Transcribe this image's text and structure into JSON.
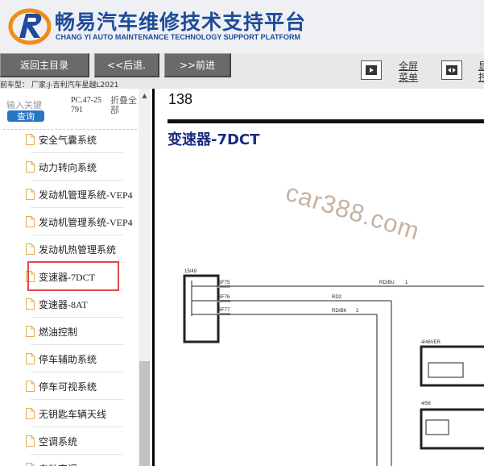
{
  "header": {
    "title_cn": "畅易汽车维修技术支持平台",
    "title_en": "CHANG YI AUTO MAINTENANCE TECHNOLOGY SUPPORT PLATFORM",
    "brand_color": "#1e4b9a",
    "accent_color": "#f08c1c"
  },
  "toolbar": {
    "home_label": "返回主目录",
    "back_label": "<<后退.",
    "forward_label": ">>前进",
    "fullscreen_menu_label_1": "全屏",
    "fullscreen_menu_label_2": "菜单",
    "cut_label_1": "显",
    "cut_label_2": "控",
    "car_model": "前车型： 厂家:J-吉利汽车星越L2021"
  },
  "sidebar": {
    "search_placeholder": "输入关键",
    "search_button": "查询",
    "doc_code": "PC.47-25791",
    "collapse_all": "折叠全部",
    "items": [
      {
        "label": "安全气囊系统"
      },
      {
        "label": "动力转向系统"
      },
      {
        "label": "发动机管理系统-VEP4"
      },
      {
        "label": "发动机管理系统-VEP4"
      },
      {
        "label": "发动机热管理系统"
      },
      {
        "label": "变速器-7DCT"
      },
      {
        "label": "变速器-8AT"
      },
      {
        "label": "燃油控制"
      },
      {
        "label": "停车辅助系统"
      },
      {
        "label": "停车可视系统"
      },
      {
        "label": "无钥匙车辆天线"
      },
      {
        "label": "空调系统"
      },
      {
        "label": "自动空调"
      }
    ],
    "selected_item": "变速器-7DCT"
  },
  "main": {
    "page_number": "138",
    "section_title": "变速器-7DCT",
    "watermark": "car388.com",
    "diagram": {
      "connector_1": "15/49",
      "pin_1": "RD/BU",
      "pin_1_num": "1",
      "wire_2": "RD2",
      "wire_3": "RD/BK",
      "wire_3_num": "2",
      "connector_2": "4/46VER",
      "connector_3": "4/56",
      "fuse_1": "SF75",
      "fuse_2": "SF76",
      "fuse_3": "SF77"
    }
  }
}
